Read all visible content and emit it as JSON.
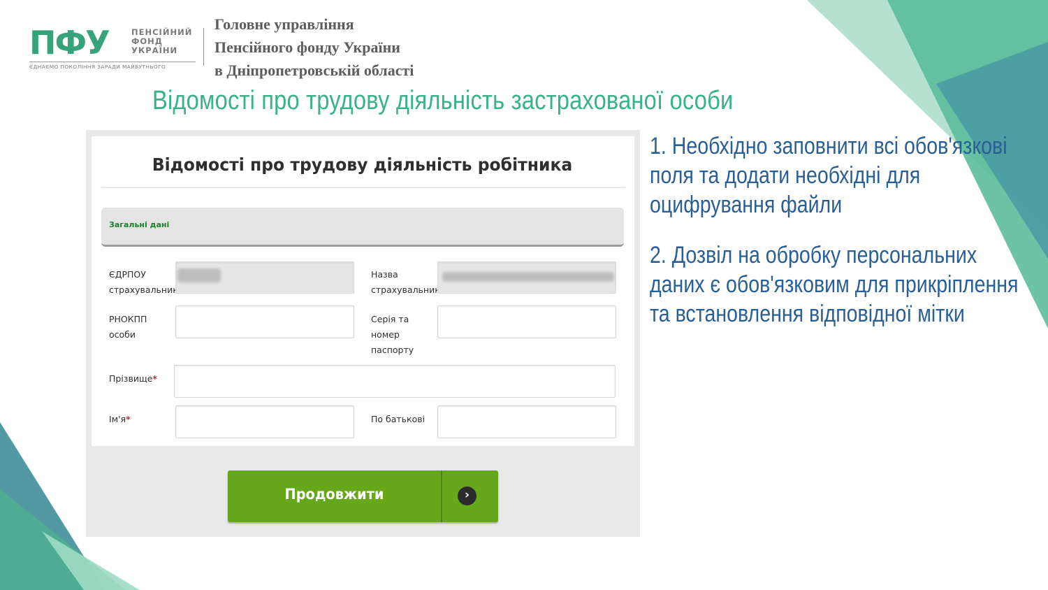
{
  "colors": {
    "brand_green": "#37a37b",
    "title_green": "#39b28a",
    "note_blue": "#2a5f95",
    "button_green": "#66a81a",
    "section_label_green": "#1d7f2a",
    "required_red": "#d0282e"
  },
  "header": {
    "logo_mark": "ПФУ",
    "logo_words": [
      "ПЕНСІЙНИЙ",
      "ФОНД",
      "УКРАЇНИ"
    ],
    "logo_tagline": "ЄДНАЄМО ПОКОЛІННЯ ЗАРАДИ МАЙБУТНЬОГО",
    "org_lines": [
      "Головне управління",
      "Пенсійного фонду України",
      "в Дніпропетровській області"
    ]
  },
  "slide_title": "Відомості про трудову діяльність застрахованої особи",
  "form": {
    "title": "Відомості про трудову діяльність робітника",
    "section_label": "Загальні дані",
    "fields": {
      "edrpou": {
        "label_lines": [
          "ЄДРПОУ",
          "страхувальника"
        ],
        "value_blurred": true,
        "disabled": true
      },
      "insurer_name": {
        "label_lines": [
          "Назва",
          "страхувальника"
        ],
        "value_blurred": true,
        "disabled": true
      },
      "rnokpp": {
        "label_lines": [
          "РНОКПП",
          "особи"
        ],
        "value": ""
      },
      "passport": {
        "label_lines": [
          "Серія та",
          "номер",
          "паспорту"
        ],
        "value": ""
      },
      "surname": {
        "label": "Прізвище",
        "required_mark": "*",
        "value": ""
      },
      "first_name": {
        "label": "Ім'я",
        "required_mark": "*",
        "value": ""
      },
      "patronymic": {
        "label": "По батькові",
        "value": ""
      }
    },
    "submit": {
      "label": "Продовжити",
      "icon": "chevron-right-icon",
      "glyph": "›"
    }
  },
  "notes": [
    "1. Необхідно заповнити всі обов'язкові поля та додати необхідні для оцифрування файли",
    "2. Дозвіл на обробку персональних даних є  обов'язковим для прикріплення та встановлення відповідної мітки"
  ]
}
